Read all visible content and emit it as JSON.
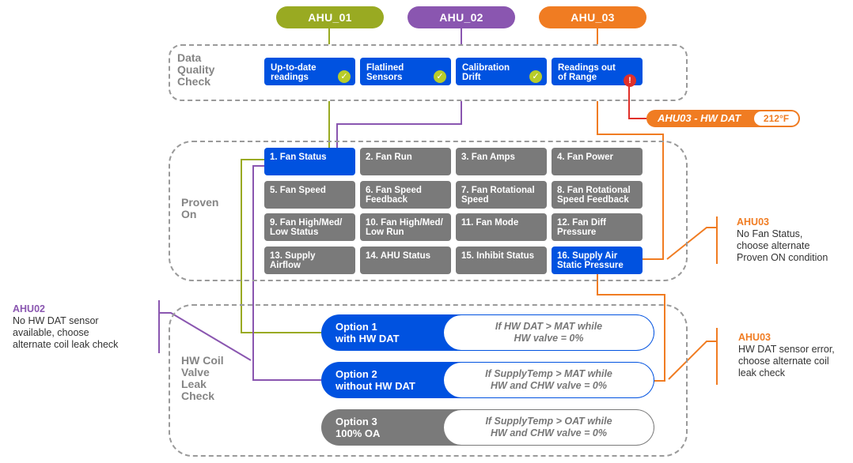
{
  "colors": {
    "ahu01": "#99aa22",
    "ahu02": "#8a56b0",
    "ahu03": "#f07c22",
    "primary_blue": "#0052e0",
    "inactive_gray": "#7a7a7a",
    "check_green": "#b8cc2a",
    "error_red": "#e0302a"
  },
  "ahus": [
    {
      "label": "AHU_01"
    },
    {
      "label": "AHU_02"
    },
    {
      "label": "AHU_03"
    }
  ],
  "data_quality": {
    "label_lines": [
      "Data",
      "Quality",
      "Check"
    ],
    "checks": [
      {
        "lines": [
          "Up-to-date",
          "readings"
        ],
        "status": "pass",
        "icon": "check-icon",
        "glyph": "✓"
      },
      {
        "lines": [
          "Flatlined",
          "Sensors"
        ],
        "status": "pass",
        "icon": "check-icon",
        "glyph": "✓"
      },
      {
        "lines": [
          "Calibration",
          "Drift"
        ],
        "status": "pass",
        "icon": "check-icon",
        "glyph": "✓"
      },
      {
        "lines": [
          "Readings out",
          "of Range"
        ],
        "status": "fail",
        "icon": "exclamation-icon",
        "glyph": "!"
      }
    ]
  },
  "alert": {
    "label": "AHU03 - HW DAT",
    "value": "212°F"
  },
  "proven_on": {
    "label_lines": [
      "Proven",
      "On"
    ],
    "conditions": [
      {
        "lines": [
          "1. Fan Status"
        ],
        "selected": true
      },
      {
        "lines": [
          "2. Fan Run"
        ],
        "selected": false
      },
      {
        "lines": [
          "3. Fan Amps"
        ],
        "selected": false
      },
      {
        "lines": [
          "4. Fan Power"
        ],
        "selected": false
      },
      {
        "lines": [
          "5. Fan Speed"
        ],
        "selected": false
      },
      {
        "lines": [
          "6. Fan Speed",
          "Feedback"
        ],
        "selected": false
      },
      {
        "lines": [
          "7. Fan Rotational",
          "Speed"
        ],
        "selected": false
      },
      {
        "lines": [
          "8. Fan Rotational",
          "Speed Feedback"
        ],
        "selected": false
      },
      {
        "lines": [
          "9. Fan High/Med/",
          "Low Status"
        ],
        "selected": false
      },
      {
        "lines": [
          "10. Fan High/Med/",
          "Low Run"
        ],
        "selected": false
      },
      {
        "lines": [
          "11. Fan Mode"
        ],
        "selected": false
      },
      {
        "lines": [
          "12. Fan Diff",
          "Pressure"
        ],
        "selected": false
      },
      {
        "lines": [
          "13. Supply",
          "Airflow"
        ],
        "selected": false
      },
      {
        "lines": [
          "14. AHU Status"
        ],
        "selected": false
      },
      {
        "lines": [
          "15. Inhibit Status"
        ],
        "selected": false
      },
      {
        "lines": [
          "16. Supply Air",
          "Static Pressure"
        ],
        "selected": true
      }
    ]
  },
  "leak_check": {
    "label_lines": [
      "HW Coil",
      "Valve",
      "Leak",
      "Check"
    ],
    "options": [
      {
        "name_lines": [
          "Option 1",
          "with HW DAT"
        ],
        "rule_lines": [
          "If HW DAT > MAT while",
          "HW valve = 0%"
        ],
        "active": true
      },
      {
        "name_lines": [
          "Option 2",
          "without HW DAT"
        ],
        "rule_lines": [
          "If SupplyTemp > MAT while",
          "HW and CHW valve = 0%"
        ],
        "active": true
      },
      {
        "name_lines": [
          "Option 3",
          "100% OA"
        ],
        "rule_lines": [
          "If SupplyTemp > OAT while",
          "HW and CHW valve = 0%"
        ],
        "active": false
      }
    ]
  },
  "notes": {
    "ahu02": {
      "title": "AHU02",
      "lines": [
        "No HW DAT sensor",
        "available, choose",
        "alternate coil leak check"
      ]
    },
    "ahu03_fan": {
      "title": "AHU03",
      "lines": [
        "No Fan Status,",
        "choose alternate",
        "Proven ON condition"
      ]
    },
    "ahu03_dat": {
      "title": "AHU03",
      "lines": [
        "HW DAT sensor error,",
        "choose alternate coil",
        "leak check"
      ]
    }
  }
}
